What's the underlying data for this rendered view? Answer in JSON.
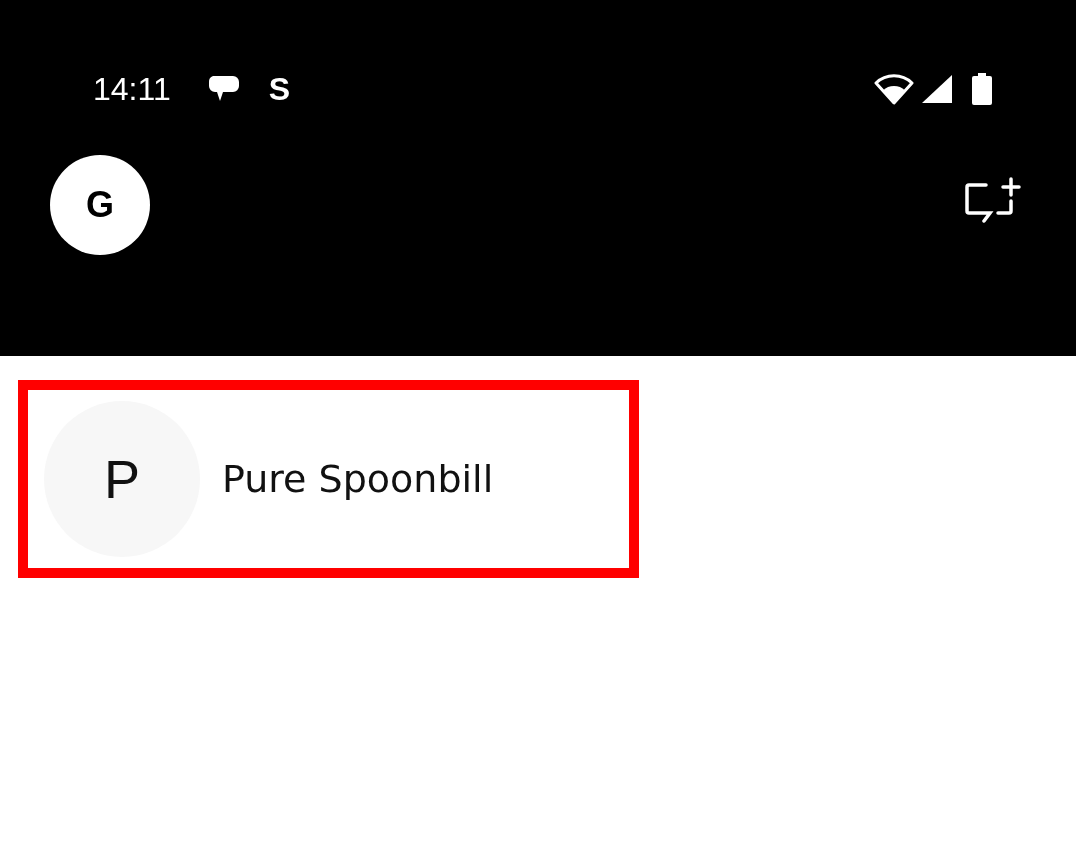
{
  "status_bar": {
    "time": "14:11",
    "app_letter": "S"
  },
  "top_bar": {
    "account_initial": "G"
  },
  "conversations": [
    {
      "initial": "P",
      "name": "Pure Spoonbill",
      "highlighted": true
    }
  ]
}
